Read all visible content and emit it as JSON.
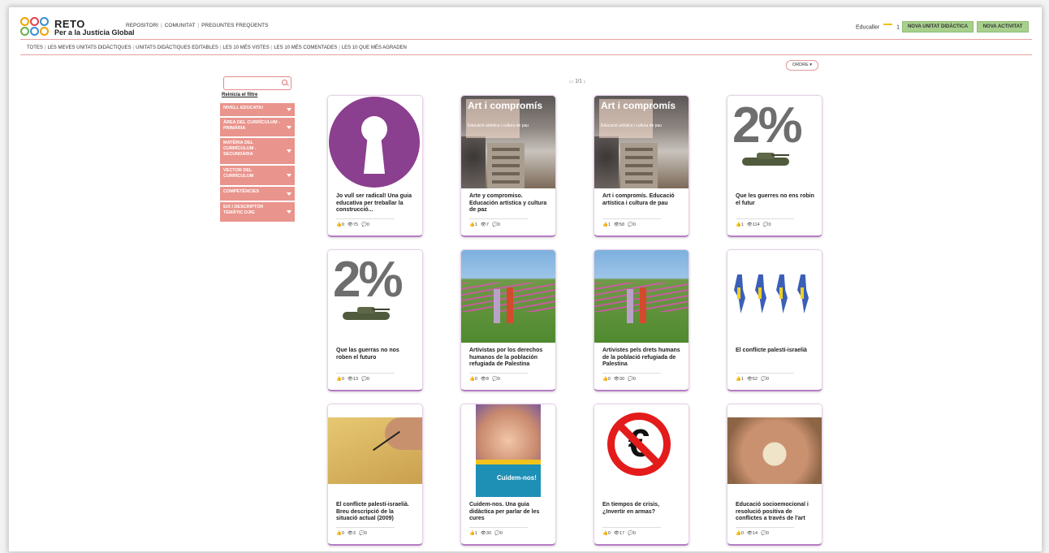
{
  "header": {
    "brand_name": "RETO",
    "brand_tagline": "Per a la Justícia Global",
    "nav": [
      "REPOSITORI",
      "COMUNITAT",
      "PREGUNTES FREQÜENTS"
    ],
    "user_name": "Educaller",
    "user_count": "1",
    "btn_new_unit": "NOVA UNITAT DIDÀCTICA",
    "btn_new_activity": "NOVA ACTIVITAT"
  },
  "filters": [
    "TOTES",
    "LES MEVES UNITATS DIDÀCTIQUES",
    "UNITATS DIDÀCTIQUES EDITABLES",
    "LES 10 MÉS VISTES",
    "LES 10 MÉS COMENTADES",
    "LES 10 QUE MÉS AGRADEN"
  ],
  "order_label": "ORDRE ▾",
  "sidebar": {
    "search_placeholder": "",
    "reset": "Reinicia el filtre",
    "facets": [
      "NIVELL EDUCATIU",
      "ÀREA DEL CURRÍCULUM - PRIMÀRIA",
      "MATÈRIA DEL CURRÍCULUM - SECUNDÀRIA",
      "VECTOR DEL CURRÍCULUM",
      "COMPETÈNCIES",
      "EIX I DESCRIPTOR TEMÀTIC DJIG"
    ]
  },
  "pager": "1/1",
  "cards": [
    {
      "title": "Jo vull ser radical! Una guia educativa per treballar la construcció...",
      "likes": "0",
      "views": "75",
      "comments": "0",
      "thumb": "keyhole"
    },
    {
      "title": "Arte y compromiso. Educación artística y cultura de paz",
      "likes": "1",
      "views": "7",
      "comments": "0",
      "thumb": "art",
      "thumb_title": "Art i compromís",
      "thumb_sub": "Educació artística i cultura de pau"
    },
    {
      "title": "Art i compromís. Educació artística i cultura de pau",
      "likes": "1",
      "views": "58",
      "comments": "0",
      "thumb": "art",
      "thumb_title": "Art i compromís",
      "thumb_sub": "Educació artística i cultura de pau"
    },
    {
      "title": "Que les guerres no ens robin el futur",
      "likes": "1",
      "views": "114",
      "comments": "0",
      "thumb": "tank",
      "thumb_text": "2%"
    },
    {
      "title": "Que las guerras no nos roben el futuro",
      "likes": "0",
      "views": "13",
      "comments": "0",
      "thumb": "tank",
      "thumb_text": "2%"
    },
    {
      "title": "Artivistas por los derechos humanos de la población refugiada de Palestina",
      "likes": "0",
      "views": "8",
      "comments": "0",
      "thumb": "field"
    },
    {
      "title": "Artivistes pels drets humans de la població refugiada de Palestina",
      "likes": "0",
      "views": "30",
      "comments": "0",
      "thumb": "field"
    },
    {
      "title": "El conflicte palestí-israelià",
      "likes": "1",
      "views": "52",
      "comments": "0",
      "thumb": "map"
    },
    {
      "title": "El conflicte palestí-israelià. Breu descripció de la situació actual (2009)",
      "likes": "0",
      "views": "3",
      "comments": "0",
      "thumb": "draw"
    },
    {
      "title": "Cuidem-nos. Una guia didàctica per parlar de les cures",
      "likes": "1",
      "views": "30",
      "comments": "0",
      "thumb": "cuidem",
      "thumb_text": "Cuidem-nos!"
    },
    {
      "title": "En tiempos de crisis, ¿Invertir en armas?",
      "likes": "0",
      "views": "17",
      "comments": "0",
      "thumb": "euro",
      "thumb_text": "€"
    },
    {
      "title": "Educació socioemocional i resolució positiva de conflictes a través de l'art",
      "likes": "0",
      "views": "14",
      "comments": "0",
      "thumb": "hands"
    }
  ],
  "colors": {
    "accent": "#e9948c",
    "green_button": "#a7d08c",
    "card_border": "#b67cc4",
    "purple": "#8b3f8f"
  }
}
